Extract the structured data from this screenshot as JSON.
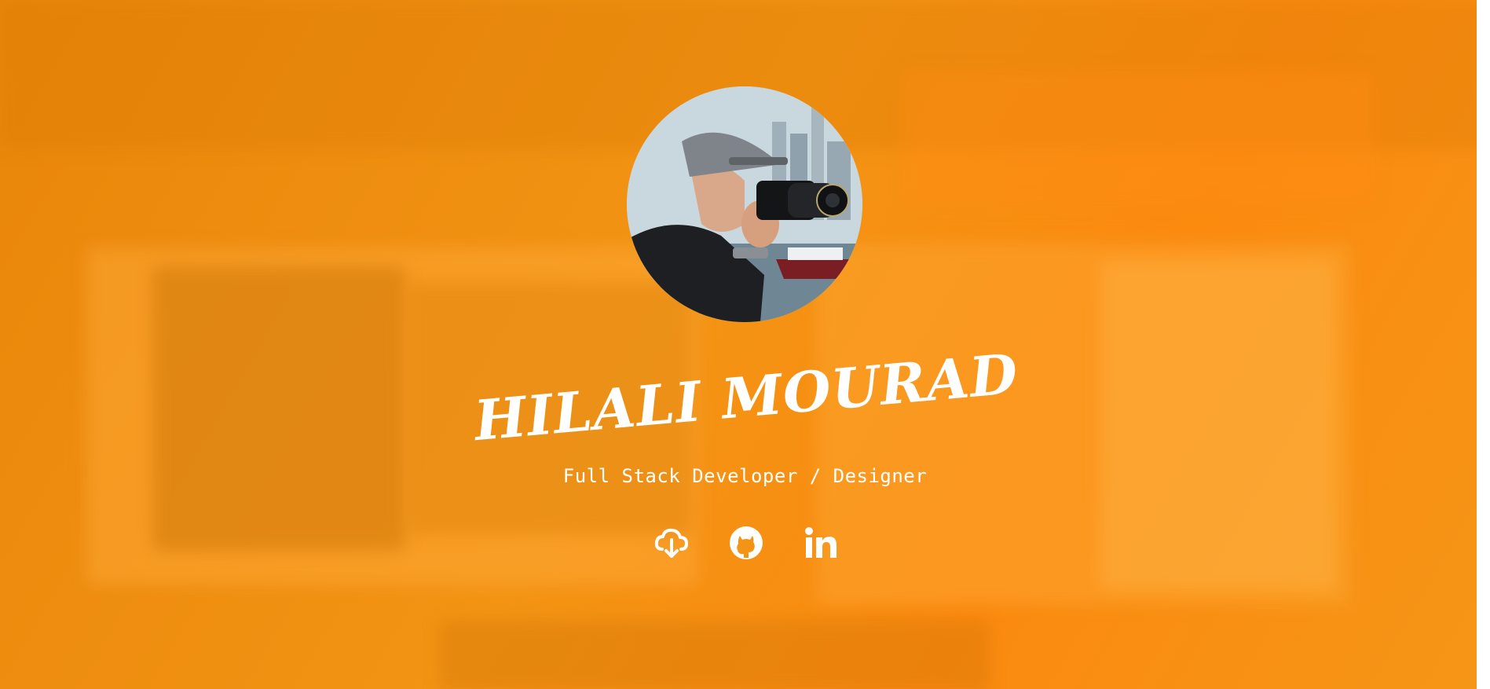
{
  "hero": {
    "name": "HILALI MOURAD",
    "subtitle": "Full Stack Developer / Designer"
  },
  "avatar": {
    "icon": "profile-photo-photographer-with-camera"
  },
  "social_links": [
    {
      "icon": "cloud-download-icon"
    },
    {
      "icon": "github-icon"
    },
    {
      "icon": "linkedin-icon"
    }
  ],
  "colors": {
    "accent": "#f39414",
    "text": "#ffffff"
  }
}
